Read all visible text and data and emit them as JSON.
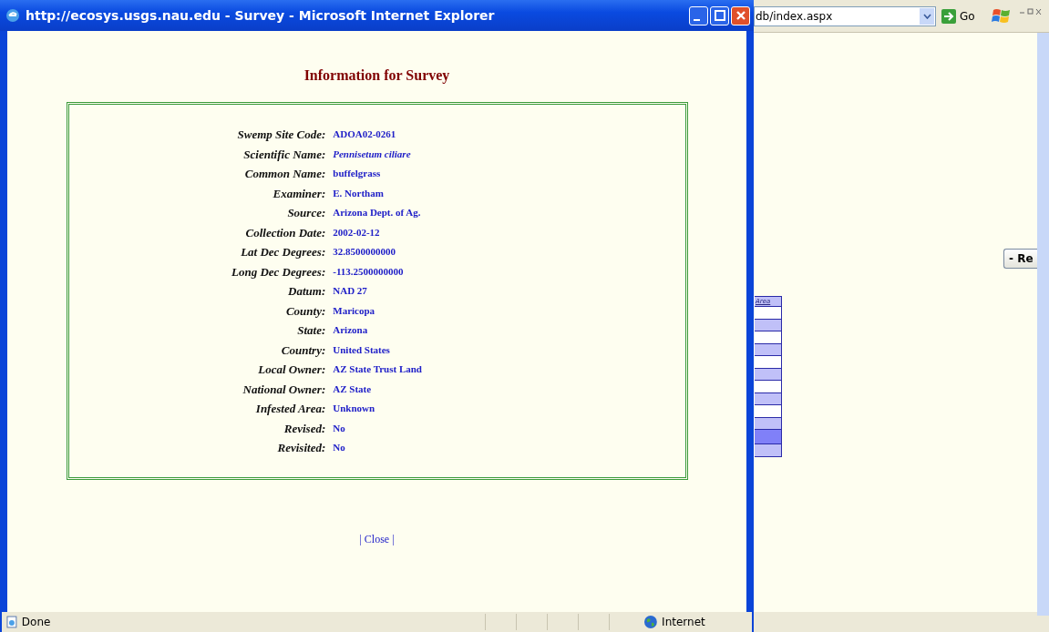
{
  "background_window": {
    "address": "db/index.aspx",
    "go_button": "Go",
    "button": "- Re",
    "table": {
      "column": "Area",
      "rows": [
        {
          "selected": false
        },
        {
          "selected": false
        },
        {
          "selected": false
        },
        {
          "selected": false
        },
        {
          "selected": false
        },
        {
          "selected": false
        },
        {
          "selected": false
        },
        {
          "selected": false
        },
        {
          "selected": false
        },
        {
          "selected": false
        },
        {
          "selected": true
        },
        {
          "selected": false
        }
      ]
    }
  },
  "popup": {
    "title": "http://ecosys.usgs.nau.edu - Survey - Microsoft Internet Explorer",
    "heading": "Information for Survey",
    "fields": [
      {
        "label": "Swemp Site Code:",
        "value": "ADOA02-0261",
        "kind": "plain"
      },
      {
        "label": "Scientific Name:",
        "value": "Pennisetum ciliare",
        "kind": "italic"
      },
      {
        "label": "Common Name:",
        "value": "buffelgrass",
        "kind": "plain"
      },
      {
        "label": "Examiner:",
        "value": "E. Northam",
        "kind": "plain"
      },
      {
        "label": "Source:",
        "value": "Arizona Dept. of Ag.",
        "kind": "plain"
      },
      {
        "label": "Collection Date:",
        "value": "2002-02-12",
        "kind": "plain"
      },
      {
        "label": "Lat Dec Degrees:",
        "value": "32.8500000000",
        "kind": "plain"
      },
      {
        "label": "Long Dec Degrees:",
        "value": "-113.2500000000",
        "kind": "plain"
      },
      {
        "label": "Datum:",
        "value": "NAD 27",
        "kind": "plain"
      },
      {
        "label": "County:",
        "value": "Maricopa",
        "kind": "plain"
      },
      {
        "label": "State:",
        "value": "Arizona",
        "kind": "plain"
      },
      {
        "label": "Country:",
        "value": "United States",
        "kind": "plain"
      },
      {
        "label": "Local Owner:",
        "value": "AZ State Trust Land",
        "kind": "plain"
      },
      {
        "label": "National Owner:",
        "value": "AZ State",
        "kind": "plain"
      },
      {
        "label": "Infested Area:",
        "value": "Unknown",
        "kind": "plain"
      },
      {
        "label": "Revised:",
        "value": "No",
        "kind": "plain"
      },
      {
        "label": "Revisited:",
        "value": "No",
        "kind": "plain"
      }
    ],
    "close_link": "| Close |",
    "status_bar": {
      "status": "Done",
      "zone": "Internet"
    }
  }
}
